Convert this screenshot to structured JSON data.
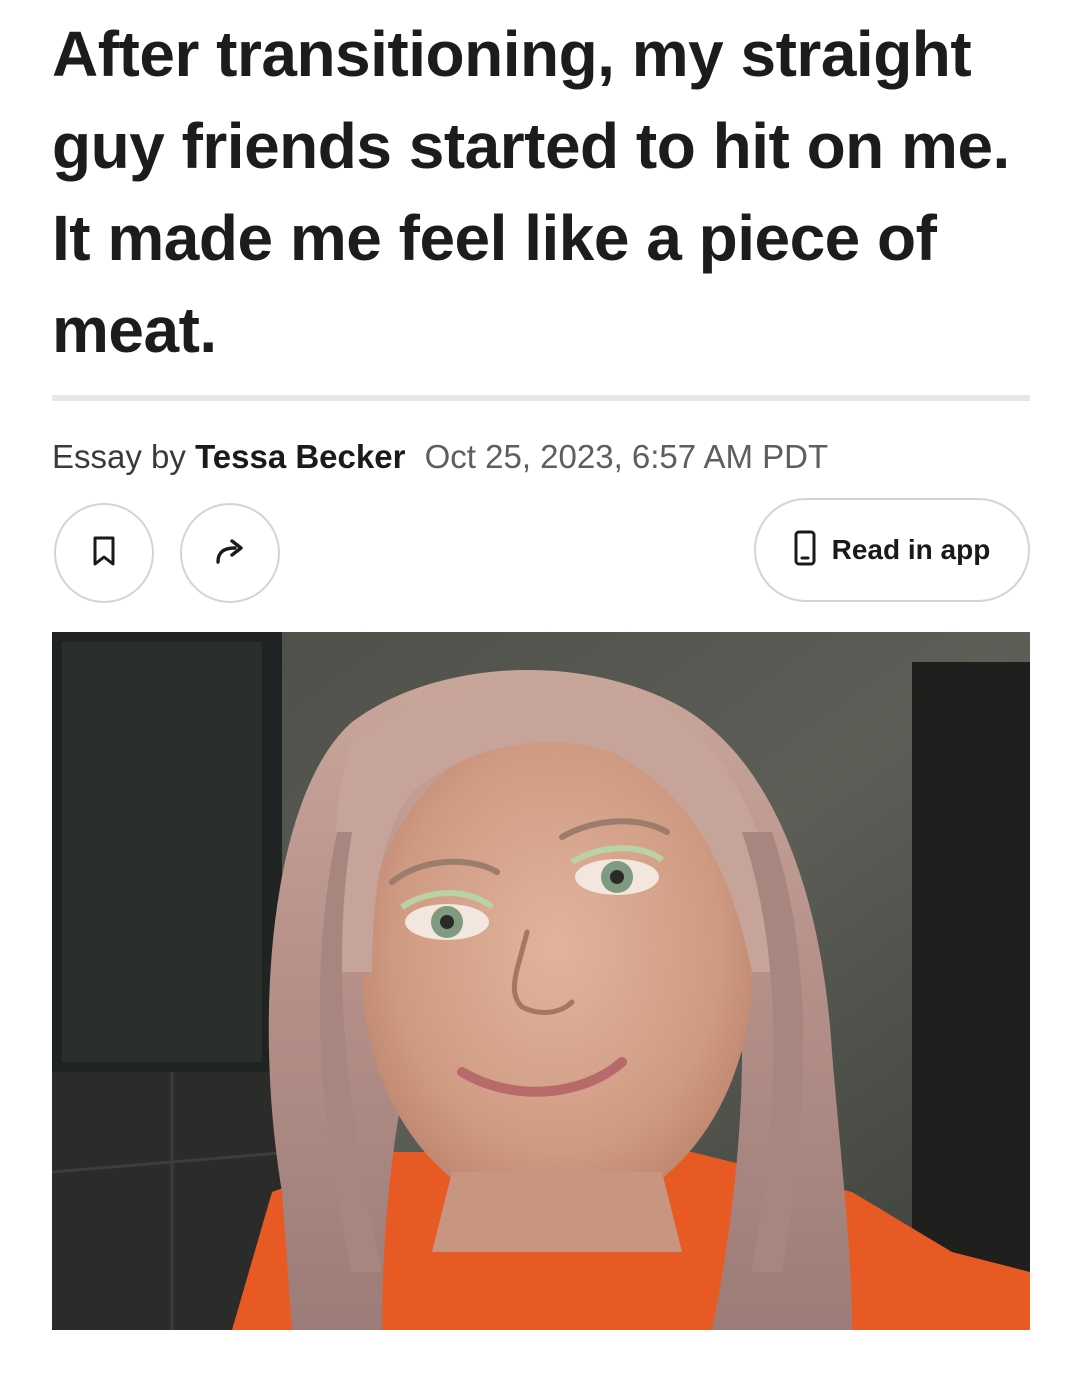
{
  "article": {
    "headline": "After transitioning, my straight guy friends started to hit on me. It made me feel like a piece of meat.",
    "byline": {
      "prefix": "Essay by",
      "author": "Tessa Becker",
      "date": "Oct 25, 2023, 6:57 AM PDT"
    }
  },
  "actions": {
    "bookmark_icon": "bookmark-icon",
    "share_icon": "share-arrow-icon",
    "read_in_app_icon": "phone-icon",
    "read_in_app_label": "Read in app"
  },
  "photo": {
    "subject": "selfie-portrait"
  },
  "colors": {
    "text": "#1c1c1c",
    "divider": "#e6e6e6",
    "button_border": "#d4d4d4"
  }
}
